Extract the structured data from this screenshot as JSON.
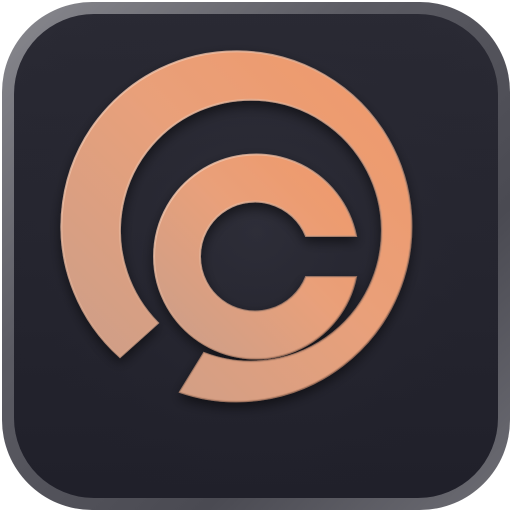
{
  "app_icon": {
    "icon": "orbit-logo-icon",
    "colors": {
      "tile_background": "#25252f",
      "tile_rim": "#6b6b72",
      "logo_primary": "#f09868",
      "logo_secondary": "#c89e8b",
      "logo_highlight": "#ffd4bb"
    }
  }
}
